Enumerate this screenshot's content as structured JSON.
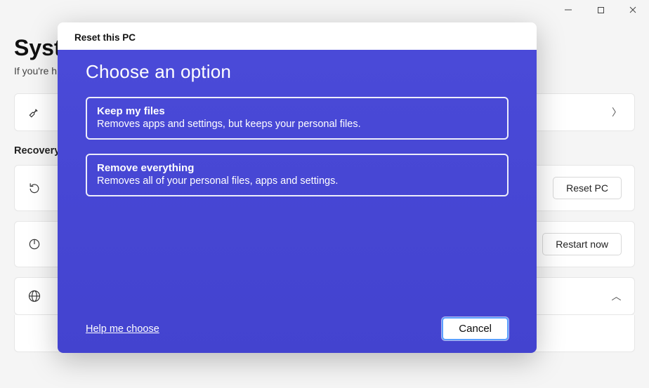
{
  "window": {
    "minimize_tip": "Minimize",
    "maximize_tip": "Maximize",
    "close_tip": "Close"
  },
  "page": {
    "title": "System",
    "subtitle_prefix": "If you're h"
  },
  "cards": {
    "troubleshoot": {
      "title": "",
      "sub": ""
    },
    "reset": {
      "title": "",
      "sub": "",
      "button": "Reset PC"
    },
    "advanced": {
      "title": "",
      "sub": "",
      "button": "Restart now"
    },
    "more": {
      "title": ""
    },
    "sub_item": {
      "title": ""
    }
  },
  "section": {
    "recovery": "Recovery"
  },
  "dialog": {
    "header_title": "Reset this PC",
    "choose_label": "Choose an option",
    "options": [
      {
        "title": "Keep my files",
        "desc": "Removes apps and settings, but keeps your personal files."
      },
      {
        "title": "Remove everything",
        "desc": "Removes all of your personal files, apps and settings."
      }
    ],
    "help_label": "Help me choose",
    "cancel_label": "Cancel"
  }
}
